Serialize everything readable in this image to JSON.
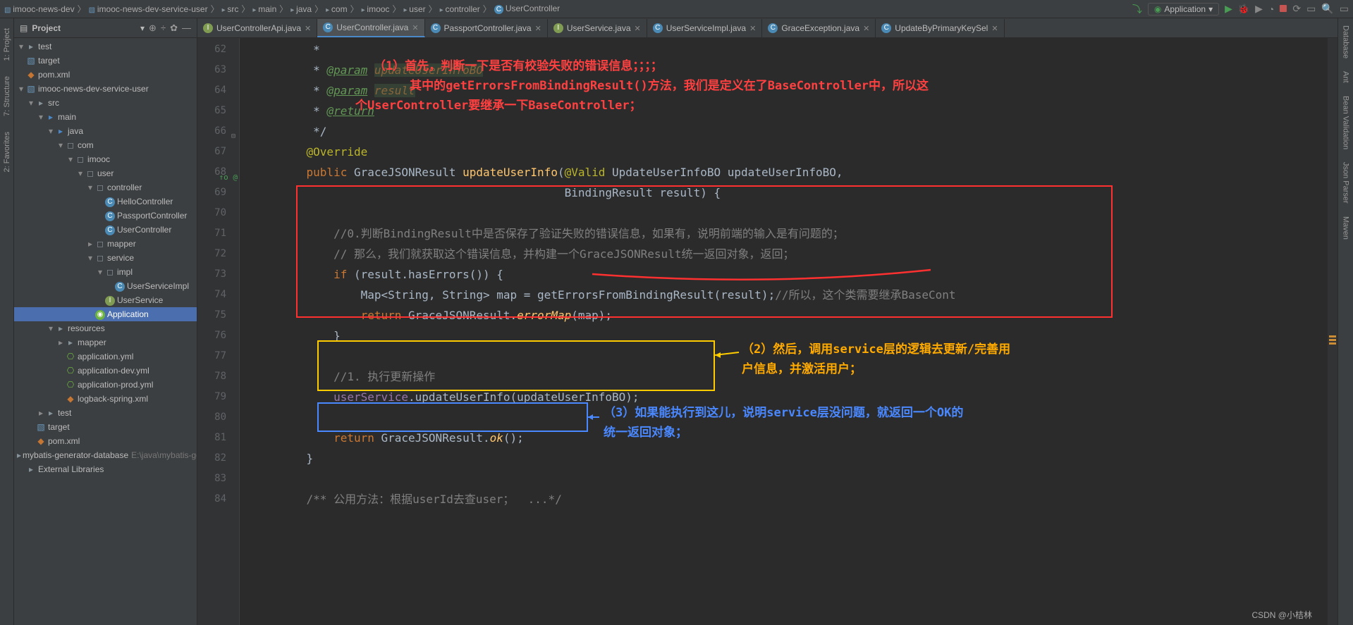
{
  "breadcrumbs": {
    "items": [
      "imooc-news-dev",
      "imooc-news-dev-service-user",
      "src",
      "main",
      "java",
      "com",
      "imooc",
      "user",
      "controller"
    ],
    "class": "UserController"
  },
  "run": {
    "config_label": "Application"
  },
  "project": {
    "title": "Project",
    "nodes": [
      {
        "indent": 0,
        "arrow": "v",
        "icon": "folder",
        "label": "test",
        "dim": ""
      },
      {
        "indent": 0,
        "arrow": " ",
        "icon": "module",
        "label": "target",
        "dim": ""
      },
      {
        "indent": 0,
        "arrow": " ",
        "icon": "xml",
        "label": "pom.xml",
        "dim": ""
      },
      {
        "indent": 0,
        "arrow": "v",
        "icon": "module",
        "label": "imooc-news-dev-service-user",
        "dim": ""
      },
      {
        "indent": 1,
        "arrow": "v",
        "icon": "folder",
        "label": "src",
        "dim": ""
      },
      {
        "indent": 2,
        "arrow": "v",
        "icon": "folder-blue",
        "label": "main",
        "dim": ""
      },
      {
        "indent": 3,
        "arrow": "v",
        "icon": "folder-blue",
        "label": "java",
        "dim": ""
      },
      {
        "indent": 4,
        "arrow": "v",
        "icon": "package",
        "label": "com",
        "dim": ""
      },
      {
        "indent": 5,
        "arrow": "v",
        "icon": "package",
        "label": "imooc",
        "dim": ""
      },
      {
        "indent": 6,
        "arrow": "v",
        "icon": "package",
        "label": "user",
        "dim": ""
      },
      {
        "indent": 7,
        "arrow": "v",
        "icon": "package",
        "label": "controller",
        "dim": ""
      },
      {
        "indent": 8,
        "arrow": " ",
        "icon": "class",
        "label": "HelloController",
        "dim": ""
      },
      {
        "indent": 8,
        "arrow": " ",
        "icon": "class",
        "label": "PassportController",
        "dim": ""
      },
      {
        "indent": 8,
        "arrow": " ",
        "icon": "class",
        "label": "UserController",
        "dim": ""
      },
      {
        "indent": 7,
        "arrow": ">",
        "icon": "package",
        "label": "mapper",
        "dim": ""
      },
      {
        "indent": 7,
        "arrow": "v",
        "icon": "package",
        "label": "service",
        "dim": ""
      },
      {
        "indent": 8,
        "arrow": "v",
        "icon": "package",
        "label": "impl",
        "dim": ""
      },
      {
        "indent": 9,
        "arrow": " ",
        "icon": "class",
        "label": "UserServiceImpl",
        "dim": ""
      },
      {
        "indent": 8,
        "arrow": " ",
        "icon": "interface",
        "label": "UserService",
        "dim": ""
      },
      {
        "indent": 7,
        "arrow": " ",
        "icon": "spring",
        "label": "Application",
        "dim": "",
        "selected": true
      },
      {
        "indent": 3,
        "arrow": "v",
        "icon": "folder",
        "label": "resources",
        "dim": ""
      },
      {
        "indent": 4,
        "arrow": ">",
        "icon": "folder",
        "label": "mapper",
        "dim": ""
      },
      {
        "indent": 4,
        "arrow": " ",
        "icon": "yml",
        "label": "application.yml",
        "dim": ""
      },
      {
        "indent": 4,
        "arrow": " ",
        "icon": "yml",
        "label": "application-dev.yml",
        "dim": ""
      },
      {
        "indent": 4,
        "arrow": " ",
        "icon": "yml",
        "label": "application-prod.yml",
        "dim": ""
      },
      {
        "indent": 4,
        "arrow": " ",
        "icon": "xml",
        "label": "logback-spring.xml",
        "dim": ""
      },
      {
        "indent": 2,
        "arrow": ">",
        "icon": "folder",
        "label": "test",
        "dim": ""
      },
      {
        "indent": 1,
        "arrow": " ",
        "icon": "module",
        "label": "target",
        "dim": ""
      },
      {
        "indent": 1,
        "arrow": " ",
        "icon": "xml",
        "label": "pom.xml",
        "dim": ""
      },
      {
        "indent": 0,
        "arrow": " ",
        "icon": "folder",
        "label": "mybatis-generator-database",
        "dim": "E:\\java\\mybatis-gener"
      },
      {
        "indent": 0,
        "arrow": " ",
        "icon": "lib",
        "label": "External Libraries",
        "dim": ""
      }
    ]
  },
  "tabs": [
    {
      "label": "UserControllerApi.java",
      "icon": "iface",
      "active": false
    },
    {
      "label": "UserController.java",
      "icon": "class",
      "active": true
    },
    {
      "label": "PassportController.java",
      "icon": "class",
      "active": false
    },
    {
      "label": "UserService.java",
      "icon": "iface",
      "active": false
    },
    {
      "label": "UserServiceImpl.java",
      "icon": "class",
      "active": false
    },
    {
      "label": "GraceException.java",
      "icon": "class",
      "active": false
    },
    {
      "label": "UpdateByPrimaryKeySel",
      "icon": "class",
      "active": false
    }
  ],
  "code": {
    "lines": [
      {
        "n": 62,
        "html": "     * "
      },
      {
        "n": 63,
        "html": "     * <span class='param-tag'>@param</span> <span class='param-name'>updateUserInfoBO</span>"
      },
      {
        "n": 64,
        "html": "     * <span class='param-tag'>@param</span> <span class='param-name'>result</span>"
      },
      {
        "n": 65,
        "html": "     * <span class='param-tag'>@return</span>"
      },
      {
        "n": 66,
        "html": "     */",
        "fold": "-"
      },
      {
        "n": 67,
        "html": "    <span class='ann'>@Override</span>"
      },
      {
        "n": 68,
        "html": "    <span class='k'>public</span> GraceJSONResult <span class='method'>updateUserInfo</span>(<span class='ann'>@Valid</span> UpdateUserInfoBO updateUserInfoBO,",
        "gutter": "override"
      },
      {
        "n": 69,
        "html": "                                          BindingResult result) {"
      },
      {
        "n": 70,
        "html": " "
      },
      {
        "n": 71,
        "html": "        <span class='cm'>//0.判断BindingResult中是否保存了验证失败的错误信息，如果有，说明前端的输入是有问题的；</span>"
      },
      {
        "n": 72,
        "html": "        <span class='cm'>// 那么，我们就获取这个错误信息，并构建一个GraceJSONResult统一返回对象，返回；</span>"
      },
      {
        "n": 73,
        "html": "        <span class='k'>if</span> (result.hasErrors()) {"
      },
      {
        "n": 74,
        "html": "            Map&lt;String, String&gt; map = getErrorsFromBindingResult(result);<span class='cm'>//所以，这个类需要继承BaseCont</span>"
      },
      {
        "n": 75,
        "html": "            <span class='k'>return</span> GraceJSONResult.<span class='method-i'>errorMap</span>(map);"
      },
      {
        "n": 76,
        "html": "        }"
      },
      {
        "n": 77,
        "html": " "
      },
      {
        "n": 78,
        "html": "        <span class='cm'>//1. 执行更新操作</span>"
      },
      {
        "n": 79,
        "html": "        <span class='field'>userService</span>.updateUserInfo(updateUserInfoBO);"
      },
      {
        "n": 80,
        "html": " "
      },
      {
        "n": 81,
        "html": "        <span class='k'>return</span> GraceJSONResult.<span class='method-i'>ok</span>();"
      },
      {
        "n": 82,
        "html": "    }"
      },
      {
        "n": 83,
        "html": " "
      },
      {
        "n": 84,
        "html": "    <span class='cm'>/** 公用方法：根据userId去查user；  ...*/</span>"
      }
    ]
  },
  "annotations": {
    "a1": "（1）首先，判断一下是否有校验失败的错误信息；；；；",
    "a1b": "     其中的getErrorsFromBindingResult()方法，我们是定义在了BaseController中，所以这",
    "a1c": "个UserController要继承一下BaseController；",
    "a2": "（2）然后，调用service层的逻辑去更新/完善用",
    "a2b": "户信息，并激活用户；",
    "a3": "（3）如果能执行到这儿，说明service层没问题，就返回一个OK的",
    "a3b": "统一返回对象；"
  },
  "side_tools": {
    "left": [
      {
        "index": "1",
        "label": "Project"
      },
      {
        "index": "7",
        "label": "Structure"
      },
      {
        "index": "2",
        "label": "Favorites"
      }
    ],
    "right": [
      {
        "label": "Database"
      },
      {
        "label": "Ant"
      },
      {
        "label": "Bean Validation"
      },
      {
        "label": "Json Parser"
      },
      {
        "label": "Maven"
      }
    ]
  },
  "watermark": "CSDN @小桔林"
}
